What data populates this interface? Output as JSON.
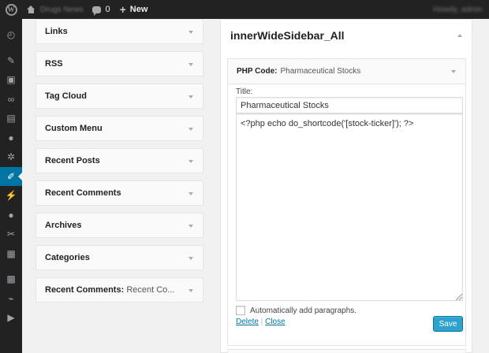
{
  "adminbar": {
    "site_name": "Drugs News",
    "comments_count": "0",
    "new_label": "New",
    "account_text": "Howdy, admin"
  },
  "available_widgets": [
    {
      "title": "Links",
      "instance": ""
    },
    {
      "title": "RSS",
      "instance": ""
    },
    {
      "title": "Tag Cloud",
      "instance": ""
    },
    {
      "title": "Custom Menu",
      "instance": ""
    },
    {
      "title": "Recent Posts",
      "instance": ""
    },
    {
      "title": "Recent Comments",
      "instance": ""
    },
    {
      "title": "Archives",
      "instance": ""
    },
    {
      "title": "Categories",
      "instance": ""
    },
    {
      "title": "Recent Comments",
      "instance": "Recent Co..."
    }
  ],
  "sidebar": {
    "title": "innerWideSidebar_All",
    "widget": {
      "type_label": "PHP Code:",
      "instance_title": "Pharmaceutical Stocks",
      "title_label": "Title:",
      "title_value": "Pharmaceutical Stocks",
      "code_value": "<?php echo do_shortcode('[stock-ticker]'); ?>",
      "autop_label": "Automatically add paragraphs.",
      "delete_label": "Delete",
      "separator": "|",
      "close_label": "Close",
      "save_label": "Save"
    }
  },
  "colors": {
    "accent": "#0074a2",
    "button": "#2ea2cc",
    "adminbar": "#222222"
  }
}
